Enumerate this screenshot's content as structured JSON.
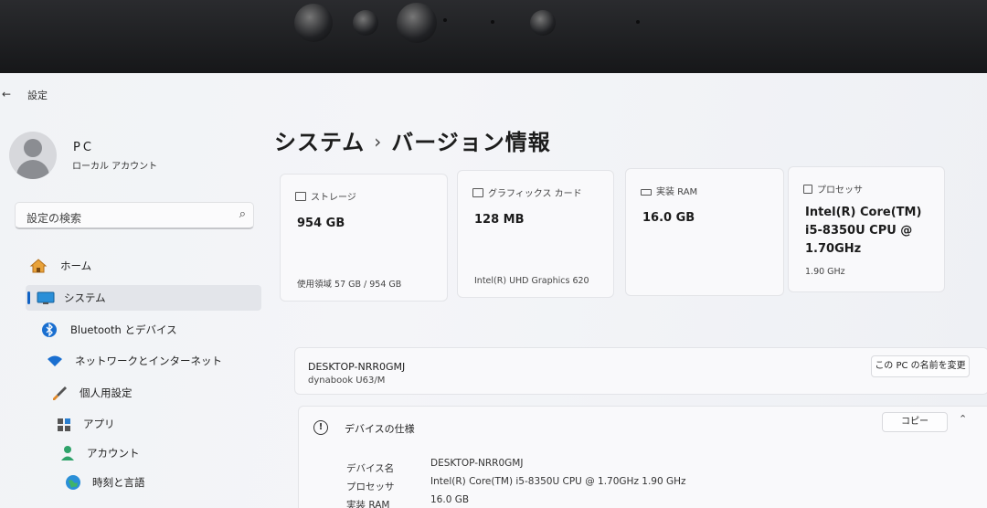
{
  "window": {
    "title": "設定"
  },
  "account": {
    "name": "PC",
    "type": "ローカル アカウント"
  },
  "search": {
    "placeholder": "設定の検索"
  },
  "nav": [
    {
      "label": "ホーム",
      "icon": "home-icon"
    },
    {
      "label": "システム",
      "icon": "monitor-icon",
      "active": true
    },
    {
      "label": "Bluetooth とデバイス",
      "icon": "bluetooth-icon"
    },
    {
      "label": "ネットワークとインターネット",
      "icon": "wifi-icon"
    },
    {
      "label": "個人用設定",
      "icon": "brush-icon"
    },
    {
      "label": "アプリ",
      "icon": "apps-icon"
    },
    {
      "label": "アカウント",
      "icon": "person-icon"
    },
    {
      "label": "時刻と言語",
      "icon": "globe-icon"
    }
  ],
  "breadcrumb": {
    "parent": "システム",
    "separator": "›",
    "current": "バージョン情報"
  },
  "cards": {
    "storage": {
      "label": "ストレージ",
      "value": "954 GB",
      "sub": "使用領域 57 GB / 954 GB"
    },
    "graphics": {
      "label": "グラフィックス カード",
      "value": "128 MB",
      "sub": "Intel(R) UHD Graphics 620"
    },
    "ram": {
      "label": "実装 RAM",
      "value": "16.0 GB",
      "sub": ""
    },
    "processor": {
      "label": "プロセッサ",
      "value": "Intel(R) Core(TM) i5-8350U CPU @ 1.70GHz",
      "sub": "1.90 GHz"
    }
  },
  "device": {
    "name": "DESKTOP-NRR0GMJ",
    "model": "dynabook U63/M",
    "rename_label": "この PC の名前を変更"
  },
  "specs": {
    "title": "デバイスの仕様",
    "copy_label": "コピー",
    "rows": [
      {
        "label": "デバイス名",
        "value": "DESKTOP-NRR0GMJ"
      },
      {
        "label": "プロセッサ",
        "value": "Intel(R) Core(TM) i5-8350U CPU @ 1.70GHz   1.90 GHz"
      },
      {
        "label": "実装 RAM",
        "value": "16.0 GB"
      }
    ]
  },
  "colors": {
    "accent": "#1062c4",
    "background": "#f3f4f7",
    "card": "#f9f9fb"
  }
}
